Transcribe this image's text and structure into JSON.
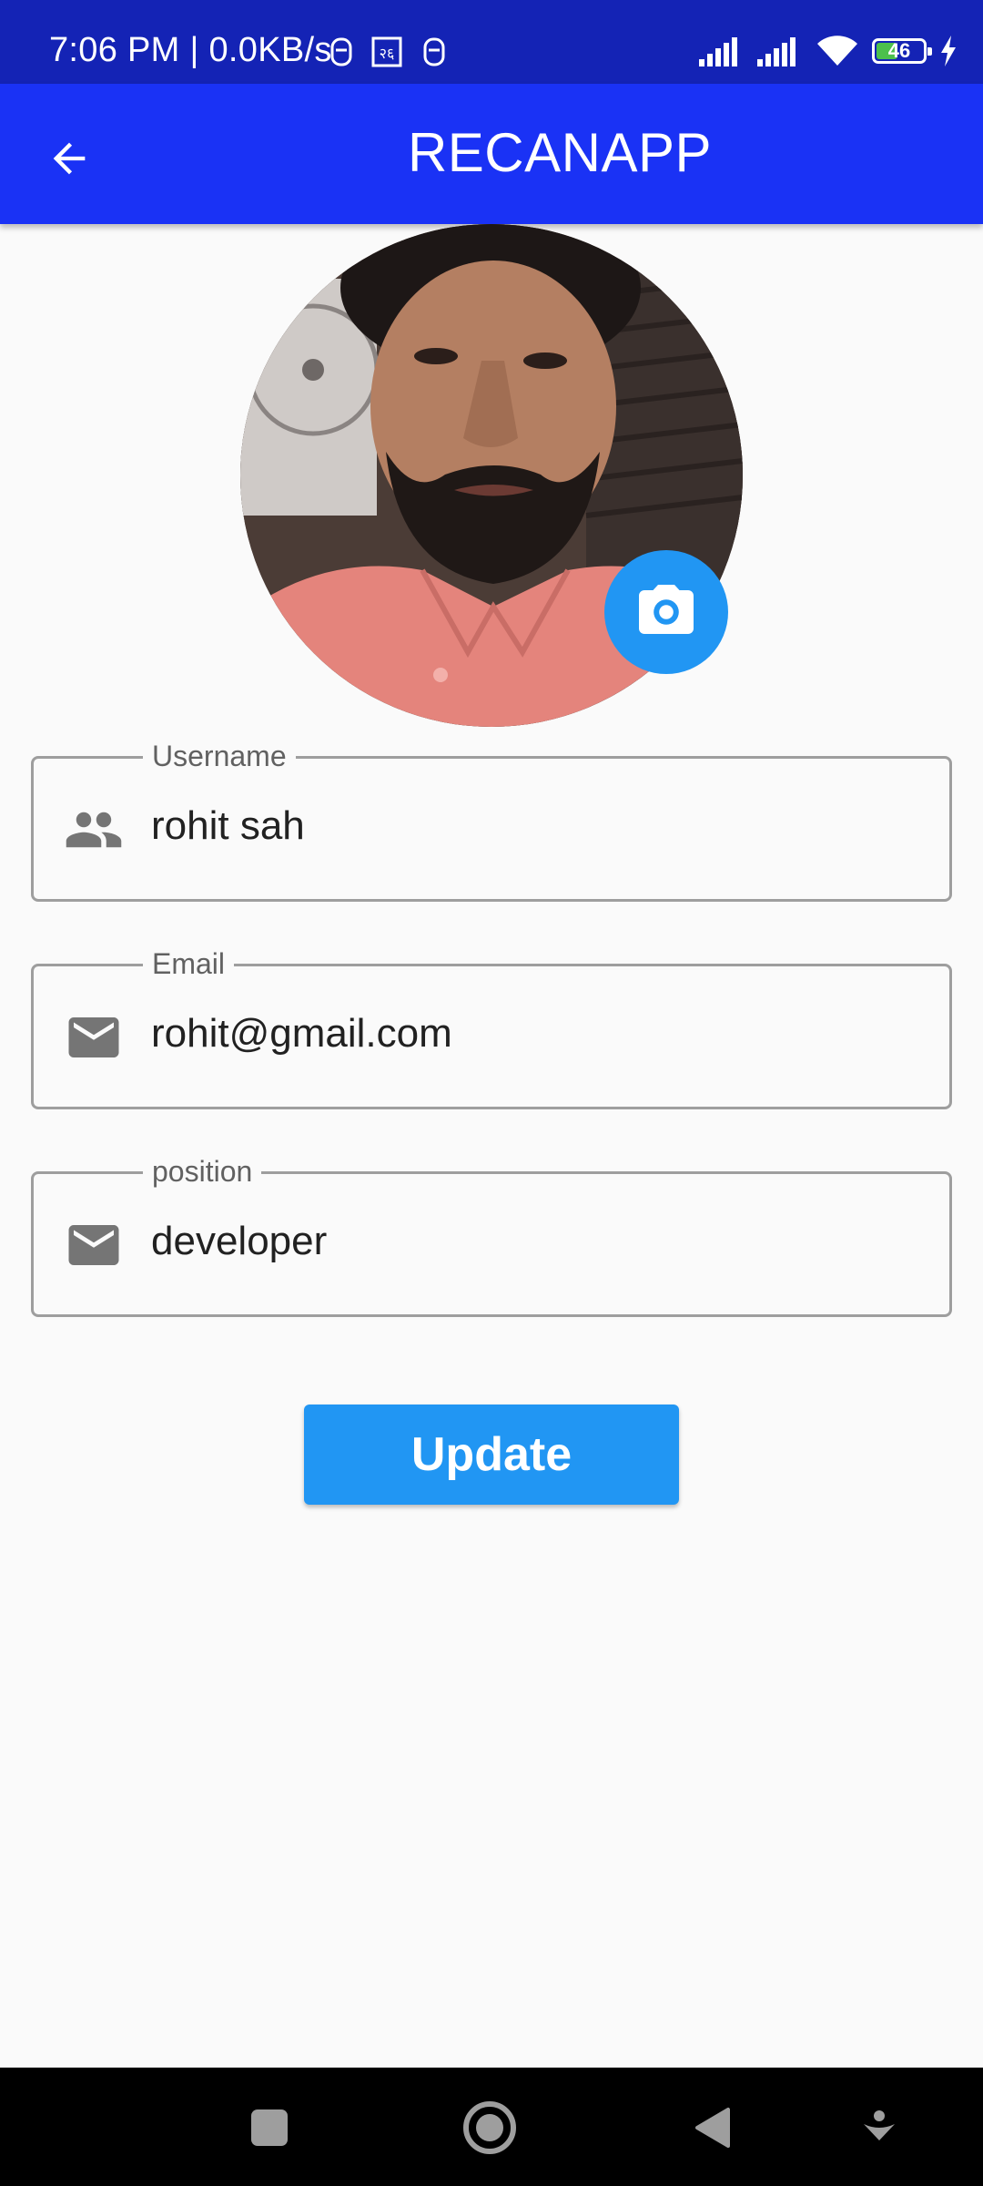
{
  "status_bar": {
    "time": "7:06 PM | 0.0KB/s",
    "battery_level": "46",
    "battery_fraction": 0.46,
    "icons": [
      "notification-icon",
      "sim-notification-icon",
      "notification-icon",
      "signal-icon",
      "signal-icon",
      "wifi-icon",
      "battery-icon",
      "charging-icon"
    ]
  },
  "app_bar": {
    "title": "RECANAPP",
    "back_icon": "arrow-back-icon"
  },
  "profile": {
    "camera_icon": "camera-icon"
  },
  "form": {
    "username": {
      "label": "Username",
      "value": "rohit sah",
      "icon": "people-icon"
    },
    "email": {
      "label": "Email",
      "value": "rohit@gmail.com",
      "icon": "mail-icon"
    },
    "position": {
      "label": "position",
      "value": "developer",
      "icon": "mail-icon"
    },
    "update_label": "Update"
  },
  "nav_bar": {
    "buttons": [
      "recents-icon",
      "home-icon",
      "back-icon",
      "hide-nav-icon"
    ]
  },
  "colors": {
    "status_bar": "#1423B5",
    "app_bar": "#1A32F5",
    "accent": "#2196F3",
    "background": "#FAFAFA"
  }
}
